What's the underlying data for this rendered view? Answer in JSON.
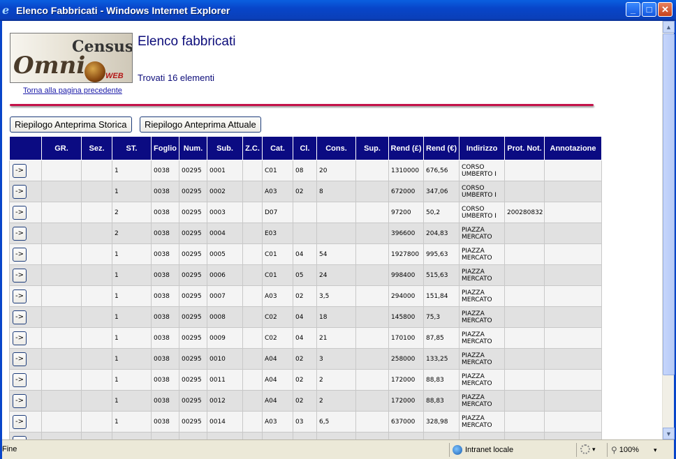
{
  "window": {
    "title": "Elenco Fabbricati - Windows Internet Explorer",
    "minimize": "_",
    "maximize": "□",
    "close": "✕"
  },
  "logo": {
    "census": "Census",
    "omni": "Omni",
    "web": "WEB"
  },
  "header": {
    "title": "Elenco fabbricati",
    "found": "Trovati 16 elementi",
    "back_link": "Torna alla pagina precedente"
  },
  "buttons": {
    "storica": "Riepilogo Anteprima Storica",
    "attuale": "Riepilogo Anteprima Attuale"
  },
  "table": {
    "headers": [
      "",
      "GR.",
      "Sez.",
      "ST.",
      "Foglio",
      "Num.",
      "Sub.",
      "Z.C.",
      "Cat.",
      "Cl.",
      "Cons.",
      "Sup.",
      "Rend (£)",
      "Rend (€)",
      "Indirizzo",
      "Prot. Not.",
      "Annotazione"
    ],
    "action_label": "->",
    "rows": [
      {
        "st": "1",
        "foglio": "0038",
        "num": "00295",
        "sub": "0001",
        "cat": "C01",
        "cl": "08",
        "cons": "20",
        "rend_l": "1310000",
        "rend_e": "676,56",
        "indirizzo": "CORSO UMBERTO I",
        "prot": ""
      },
      {
        "st": "1",
        "foglio": "0038",
        "num": "00295",
        "sub": "0002",
        "cat": "A03",
        "cl": "02",
        "cons": "8",
        "rend_l": "672000",
        "rend_e": "347,06",
        "indirizzo": "CORSO UMBERTO I",
        "prot": ""
      },
      {
        "st": "2",
        "foglio": "0038",
        "num": "00295",
        "sub": "0003",
        "cat": "D07",
        "cl": "",
        "cons": "",
        "rend_l": "97200",
        "rend_e": "50,2",
        "indirizzo": "CORSO UMBERTO I",
        "prot": "200280832"
      },
      {
        "st": "2",
        "foglio": "0038",
        "num": "00295",
        "sub": "0004",
        "cat": "E03",
        "cl": "",
        "cons": "",
        "rend_l": "396600",
        "rend_e": "204,83",
        "indirizzo": "PIAZZA MERCATO",
        "prot": ""
      },
      {
        "st": "1",
        "foglio": "0038",
        "num": "00295",
        "sub": "0005",
        "cat": "C01",
        "cl": "04",
        "cons": "54",
        "rend_l": "1927800",
        "rend_e": "995,63",
        "indirizzo": "PIAZZA MERCATO",
        "prot": ""
      },
      {
        "st": "1",
        "foglio": "0038",
        "num": "00295",
        "sub": "0006",
        "cat": "C01",
        "cl": "05",
        "cons": "24",
        "rend_l": "998400",
        "rend_e": "515,63",
        "indirizzo": "PIAZZA MERCATO",
        "prot": ""
      },
      {
        "st": "1",
        "foglio": "0038",
        "num": "00295",
        "sub": "0007",
        "cat": "A03",
        "cl": "02",
        "cons": "3,5",
        "rend_l": "294000",
        "rend_e": "151,84",
        "indirizzo": "PIAZZA MERCATO",
        "prot": ""
      },
      {
        "st": "1",
        "foglio": "0038",
        "num": "00295",
        "sub": "0008",
        "cat": "C02",
        "cl": "04",
        "cons": "18",
        "rend_l": "145800",
        "rend_e": "75,3",
        "indirizzo": "PIAZZA MERCATO",
        "prot": ""
      },
      {
        "st": "1",
        "foglio": "0038",
        "num": "00295",
        "sub": "0009",
        "cat": "C02",
        "cl": "04",
        "cons": "21",
        "rend_l": "170100",
        "rend_e": "87,85",
        "indirizzo": "PIAZZA MERCATO",
        "prot": ""
      },
      {
        "st": "1",
        "foglio": "0038",
        "num": "00295",
        "sub": "0010",
        "cat": "A04",
        "cl": "02",
        "cons": "3",
        "rend_l": "258000",
        "rend_e": "133,25",
        "indirizzo": "PIAZZA MERCATO",
        "prot": ""
      },
      {
        "st": "1",
        "foglio": "0038",
        "num": "00295",
        "sub": "0011",
        "cat": "A04",
        "cl": "02",
        "cons": "2",
        "rend_l": "172000",
        "rend_e": "88,83",
        "indirizzo": "PIAZZA MERCATO",
        "prot": ""
      },
      {
        "st": "1",
        "foglio": "0038",
        "num": "00295",
        "sub": "0012",
        "cat": "A04",
        "cl": "02",
        "cons": "2",
        "rend_l": "172000",
        "rend_e": "88,83",
        "indirizzo": "PIAZZA MERCATO",
        "prot": ""
      },
      {
        "st": "1",
        "foglio": "0038",
        "num": "00295",
        "sub": "0014",
        "cat": "A03",
        "cl": "03",
        "cons": "6,5",
        "rend_l": "637000",
        "rend_e": "328,98",
        "indirizzo": "PIAZZA MERCATO",
        "prot": ""
      },
      {
        "st": "",
        "foglio": "",
        "num": "",
        "sub": "",
        "cat": "",
        "cl": "",
        "cons": "",
        "rend_l": "",
        "rend_e": "",
        "indirizzo": "PIAZZA",
        "prot": ""
      }
    ]
  },
  "statusbar": {
    "status": "Fine",
    "zone": "Intranet locale",
    "protect_caret": "▾",
    "zoom": "100%",
    "zoom_caret": "▾"
  }
}
